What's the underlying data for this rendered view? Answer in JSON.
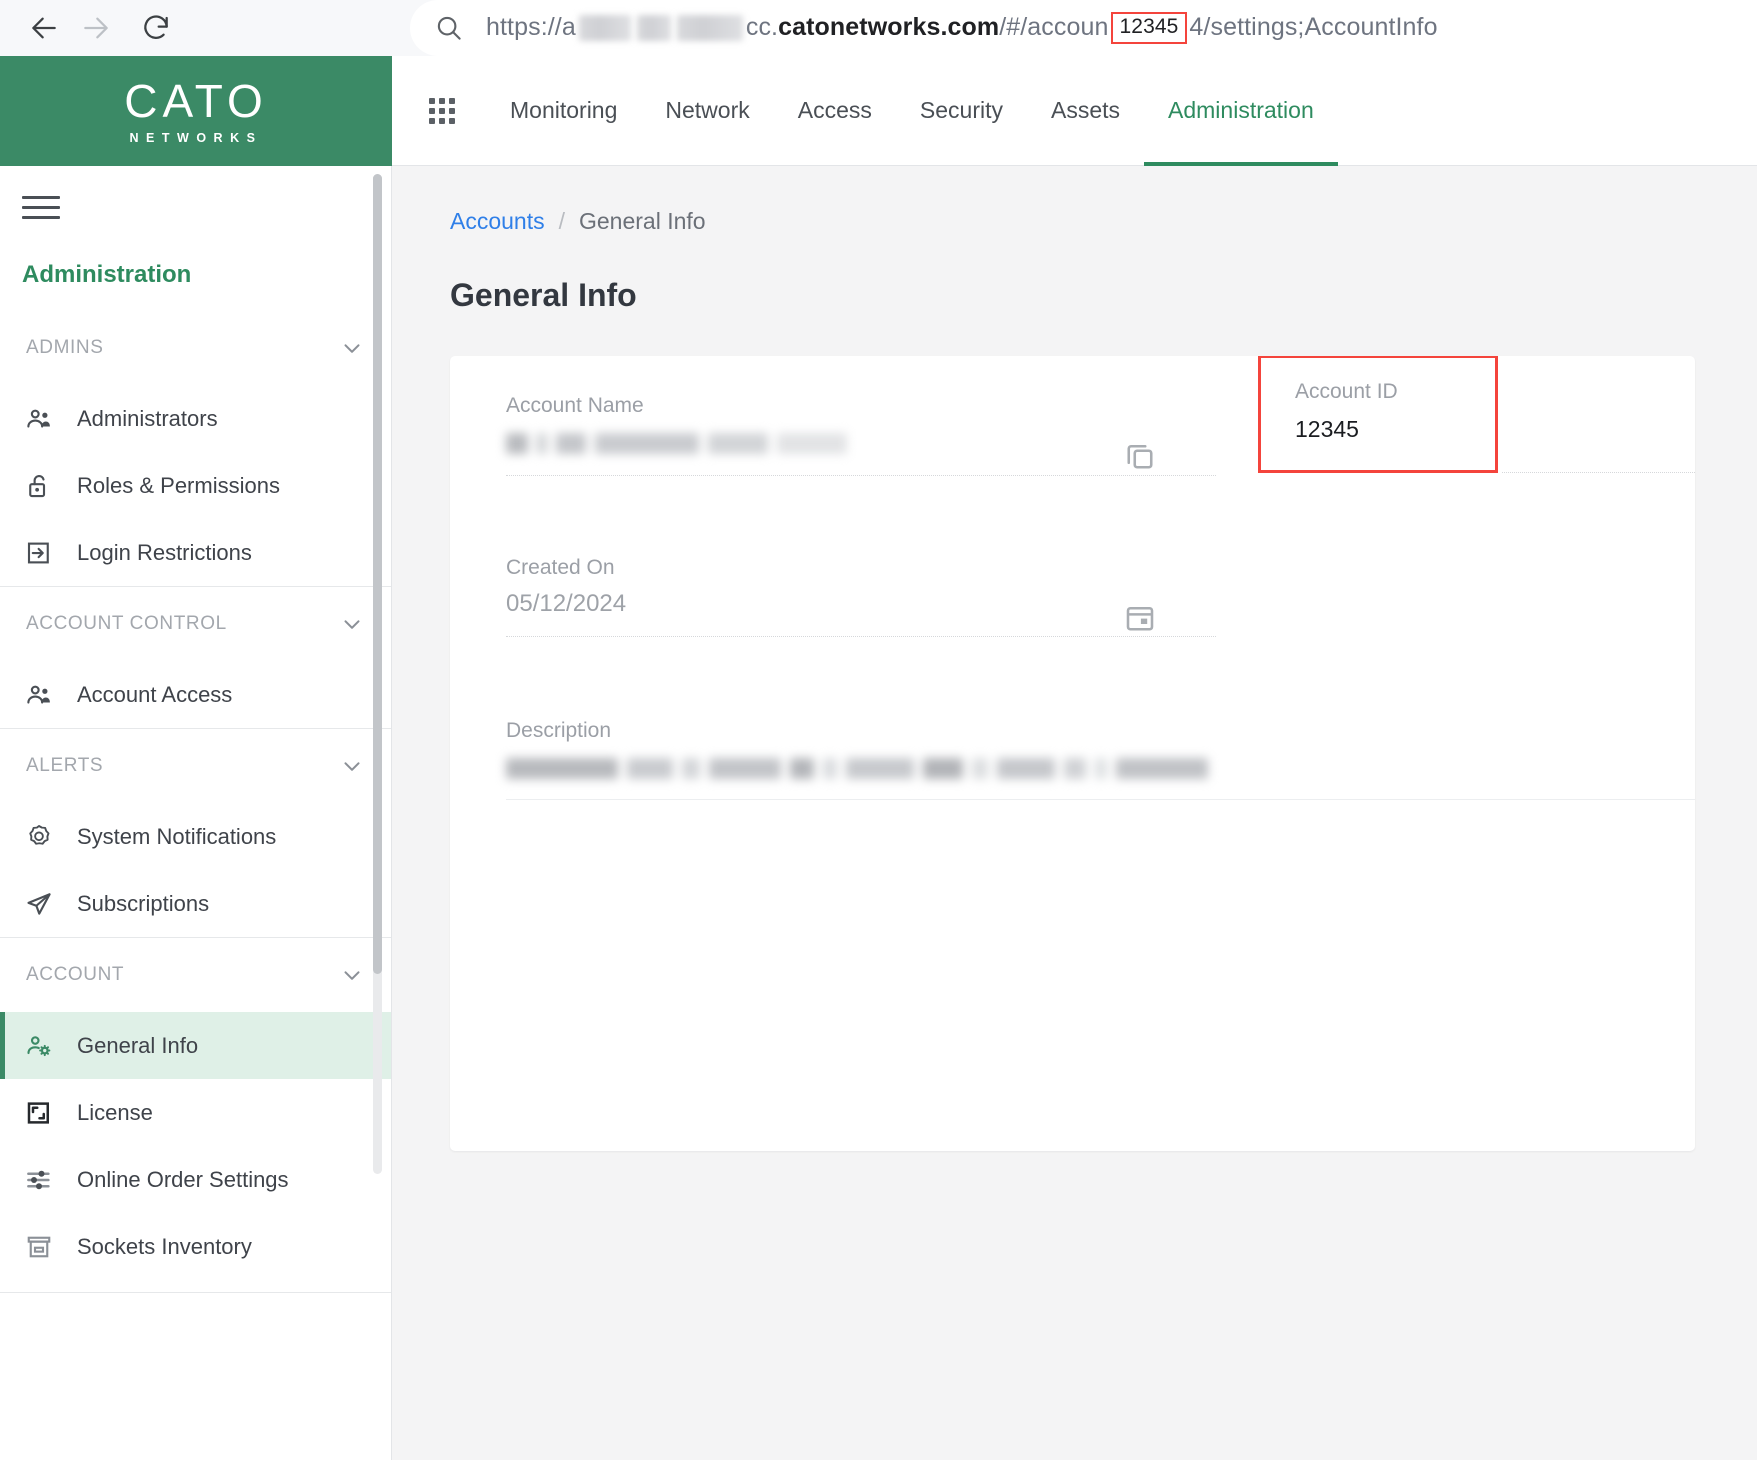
{
  "browser": {
    "back_icon": "arrow-left-icon",
    "forward_icon": "arrow-right-icon",
    "reload_icon": "reload-icon",
    "search_icon": "search-icon",
    "url_prefix": "https://a",
    "url_domain_dim": "cc.",
    "url_domain_strong": "catonetworks.com",
    "url_path_mid": "/#/accoun",
    "url_highlight": "12345",
    "url_path_end": "4/settings;AccountInfo"
  },
  "header": {
    "logo_main": "CATO",
    "logo_sub": "NETWORKS",
    "apps_icon": "apps-grid-icon",
    "nav": [
      {
        "label": "Monitoring",
        "active": false
      },
      {
        "label": "Network",
        "active": false
      },
      {
        "label": "Access",
        "active": false
      },
      {
        "label": "Security",
        "active": false
      },
      {
        "label": "Assets",
        "active": false
      },
      {
        "label": "Administration",
        "active": true
      }
    ]
  },
  "sidebar": {
    "menu_icon": "hamburger-icon",
    "title": "Administration",
    "groups": [
      {
        "label": "ADMINS",
        "chevron": "chevron-down-icon"
      },
      {
        "label": "ACCOUNT CONTROL",
        "chevron": "chevron-down-icon"
      },
      {
        "label": "ALERTS",
        "chevron": "chevron-down-icon"
      },
      {
        "label": "ACCOUNT",
        "chevron": "chevron-down-icon"
      }
    ],
    "items": {
      "administrators": "Administrators",
      "roles_permissions": "Roles & Permissions",
      "login_restrictions": "Login Restrictions",
      "account_access": "Account Access",
      "system_notifications": "System Notifications",
      "subscriptions": "Subscriptions",
      "general_info": "General Info",
      "license": "License",
      "online_order_settings": "Online Order Settings",
      "sockets_inventory": "Sockets Inventory"
    }
  },
  "main": {
    "breadcrumb": {
      "root": "Accounts",
      "separator": "/",
      "current": "General Info"
    },
    "page_title": "General Info",
    "fields": {
      "account_name_label": "Account Name",
      "account_name_value": "",
      "copy_icon": "copy-icon",
      "account_id_label": "Account ID",
      "account_id_value": "12345",
      "created_on_label": "Created On",
      "created_on_value": "05/12/2024",
      "calendar_icon": "calendar-icon",
      "description_label": "Description",
      "description_value": ""
    }
  },
  "colors": {
    "brand_green": "#3b8a66",
    "accent_green": "#2e8b5f",
    "highlight_red": "#f4443c",
    "link_blue": "#2f7fe8",
    "selected_bg": "#dff0e7"
  }
}
